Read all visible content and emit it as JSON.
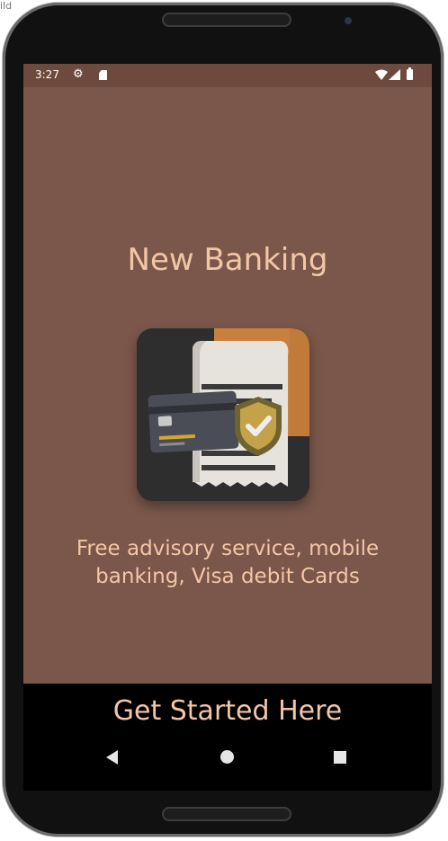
{
  "corner_label": "ild",
  "status_bar": {
    "time": "3:27",
    "icons": [
      "gear-icon",
      "sd-card-icon",
      "wifi-icon",
      "signal-icon",
      "battery-icon"
    ]
  },
  "onboarding": {
    "title": "New Banking",
    "illustration": "card-shield-receipt-illustration",
    "description": "Free advisory service, mobile banking, Visa debit Cards",
    "cta_label": "Get Started Here"
  },
  "navigation": {
    "buttons": [
      "back-icon",
      "home-icon",
      "recents-icon"
    ]
  },
  "colors": {
    "app_background": "#7a574a",
    "status_bar": "#6e4a3e",
    "accent_text": "#f4c6a8",
    "bottom_bar": "#000000"
  }
}
